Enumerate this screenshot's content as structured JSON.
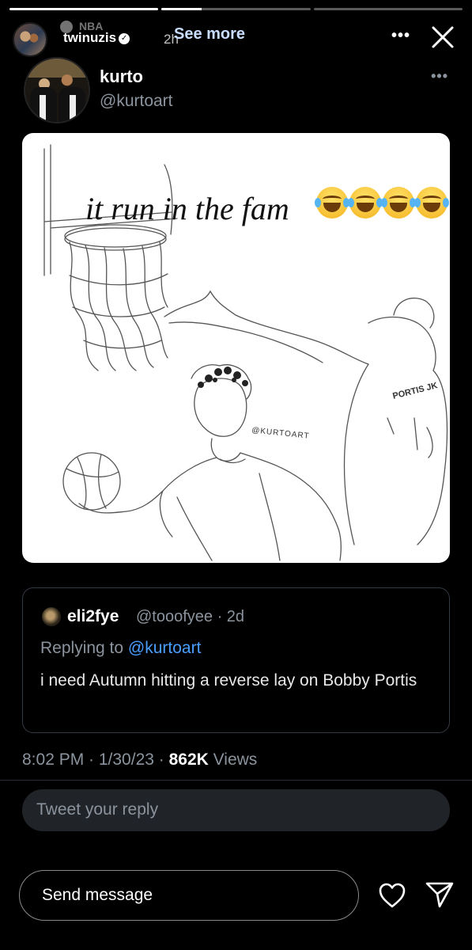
{
  "story": {
    "progress": [
      1.0,
      0.27,
      0.0
    ],
    "username": "twinuzis",
    "source": "NBA",
    "time": "2h",
    "see_more": "See more",
    "more_icon": "ellipsis-icon",
    "close_icon": "close-icon"
  },
  "tweet": {
    "author_name": "kurto",
    "author_handle": "@kurtoart",
    "more_label": "•••",
    "image": {
      "caption": "it run in the fam",
      "emoji": "😂😂😂😂",
      "watermark": "@KURTOART",
      "jersey_text": "PORTIS JK"
    },
    "quote": {
      "name": "eli2fye",
      "handle": "@tooofyee · 2d",
      "replying_prefix": "Replying to",
      "replying_to": "@kurtoart",
      "text": "i need Autumn hitting a reverse lay on Bobby Portis"
    },
    "meta": {
      "time_date": "8:02 PM · 1/30/23 ·",
      "views_count": "862K",
      "views_label": "Views"
    },
    "reply_placeholder": "Tweet your reply"
  },
  "bottom": {
    "send_message_placeholder": "Send message",
    "like_icon": "heart-icon",
    "share_icon": "send-icon"
  }
}
